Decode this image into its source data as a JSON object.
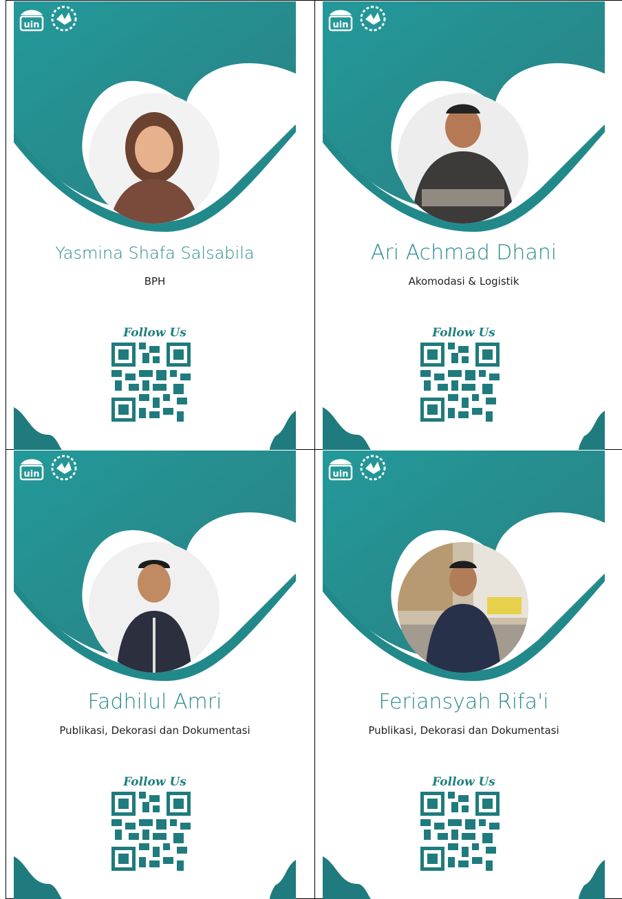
{
  "colors": {
    "teal": "#2a8a8c",
    "teal_dark": "#1f7b7d",
    "text": "#222222"
  },
  "logos": {
    "uin_label": "uin",
    "prodisi_label": "PRODISI"
  },
  "follow_label": "Follow Us",
  "cards": [
    {
      "name": "Yasmina Shafa Salsabila",
      "role": "BPH"
    },
    {
      "name": "Ari Achmad Dhani",
      "role": "Akomodasi & Logistik"
    },
    {
      "name": "Fadhilul Amri",
      "role": "Publikasi, Dekorasi dan Dokumentasi"
    },
    {
      "name": "Feriansyah Rifa'i",
      "role": "Publikasi, Dekorasi dan Dokumentasi"
    }
  ]
}
